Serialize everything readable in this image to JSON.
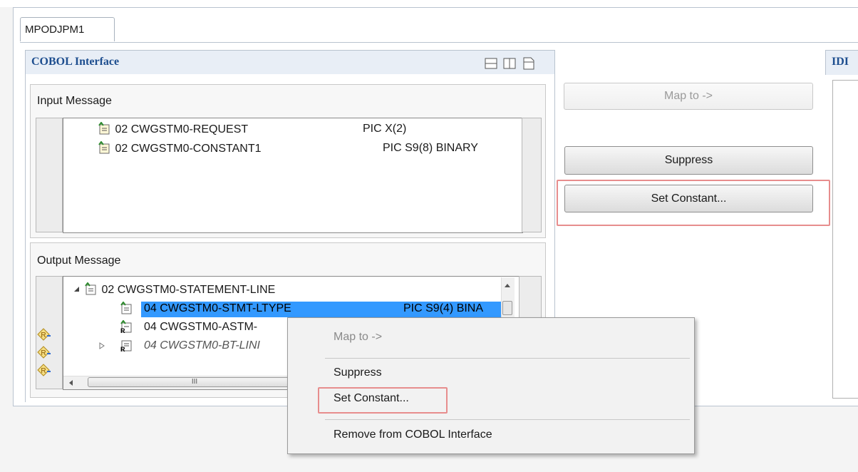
{
  "editor": {
    "tab_label": "MPODJPM1"
  },
  "cobol_interface": {
    "title": "COBOL Interface"
  },
  "idl_section": {
    "title_fragment": "IDI"
  },
  "input_message": {
    "label": "Input Message",
    "rows": [
      {
        "name": "02 CWGSTM0-REQUEST",
        "pic": "PIC X(2)"
      },
      {
        "name": "02 CWGSTM0-CONSTANT1",
        "pic": "PIC S9(8) BINARY"
      }
    ]
  },
  "output_message": {
    "label": "Output Message",
    "rows": [
      {
        "name": "02 CWGSTM0-STATEMENT-LINE",
        "pic": ""
      },
      {
        "name": "04 CWGSTM0-STMT-LTYPE",
        "pic": "PIC S9(4) BINA"
      },
      {
        "name": "04 CWGSTM0-ASTM-",
        "pic": ""
      },
      {
        "name": "04 CWGSTM0-BT-LINI",
        "pic": ""
      }
    ],
    "hscroll_grip": "III"
  },
  "actions": {
    "map_to": "Map to ->",
    "suppress": "Suppress",
    "set_constant": "Set Constant..."
  },
  "context_menu": {
    "map_to": "Map to ->",
    "suppress": "Suppress",
    "set_constant": "Set Constant...",
    "remove": "Remove from COBOL Interface"
  },
  "colors": {
    "selection": "#3399ff",
    "section_title": "#1d4e8f",
    "highlight_box": "#e78d8d"
  }
}
